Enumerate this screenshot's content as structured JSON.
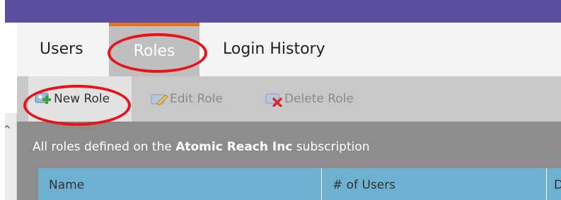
{
  "tabs": [
    {
      "label": "Users",
      "active": false
    },
    {
      "label": "Roles",
      "active": true
    },
    {
      "label": "Login History",
      "active": false
    }
  ],
  "toolbar": {
    "new_role": "New Role",
    "edit_role": "Edit Role",
    "delete_role": "Delete Role"
  },
  "description": {
    "prefix": "All roles defined on the ",
    "subscription": "Atomic Reach Inc",
    "suffix": " subscription"
  },
  "table": {
    "columns": [
      "Name",
      "# of Users",
      "D"
    ]
  },
  "sidebar": {
    "collapse_glyph": "^"
  },
  "colors": {
    "top_bar": "#5a4ea0",
    "active_tab_accent": "#e5711d",
    "table_header": "#6db0cf",
    "annotation": "#e8131b"
  },
  "icons": [
    "new-role-icon",
    "edit-role-icon",
    "delete-role-icon",
    "collapse-caret-icon"
  ]
}
